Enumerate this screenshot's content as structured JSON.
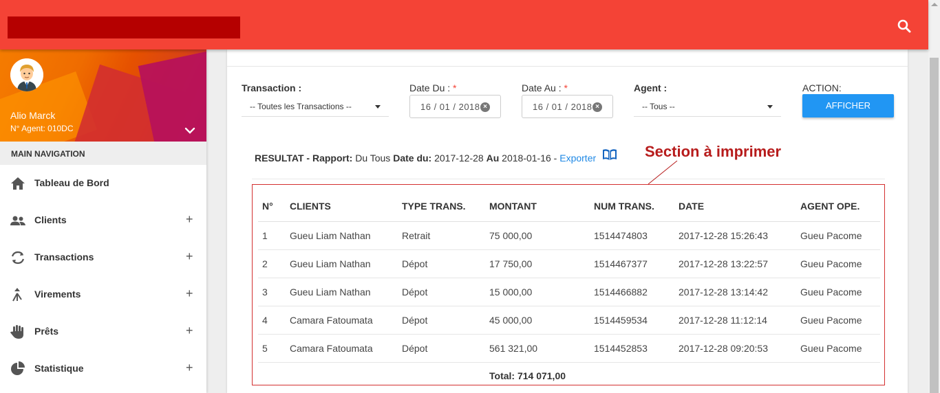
{
  "topbar": {
    "brand_color": "#b50000",
    "search_icon": "search-icon"
  },
  "user": {
    "name": "Alio Marck",
    "agent": "N° Agent: 010DC"
  },
  "nav": {
    "header": "MAIN NAVIGATION",
    "items": [
      {
        "label": "Tableau de Bord",
        "icon": "home-icon",
        "expandable": false
      },
      {
        "label": "Clients",
        "icon": "users-icon",
        "expandable": true
      },
      {
        "label": "Transactions",
        "icon": "sync-icon",
        "expandable": true
      },
      {
        "label": "Virements",
        "icon": "merge-icon",
        "expandable": true
      },
      {
        "label": "Prêts",
        "icon": "hand-icon",
        "expandable": true
      },
      {
        "label": "Statistique",
        "icon": "pie-chart-icon",
        "expandable": true
      }
    ],
    "plus": "+"
  },
  "filters": {
    "transaction_label": "Transaction :",
    "transaction_value": "-- Toutes les Transactions --",
    "date_du_label": "Date Du :",
    "date_du_value": "16 / 01 / 2018",
    "date_au_label": "Date Au :",
    "date_au_value": "16 / 01 / 2018",
    "required_mark": "*",
    "agent_label": "Agent :",
    "agent_value": "-- Tous --",
    "action_label": "ACTION:",
    "afficher_button": "AFFICHER"
  },
  "result": {
    "resultat": "RESULTAT - Rapport:",
    "rapport_value": "Du Tous",
    "date_du_label": "Date du:",
    "date_du_value": "2017-12-28",
    "au_label": "Au",
    "au_value": "2018-01-16 -",
    "export_link": "Exporter"
  },
  "annotation": {
    "text": "Section à imprimer"
  },
  "table": {
    "columns": [
      "N°",
      "CLIENTS",
      "TYPE TRANS.",
      "MONTANT",
      "NUM TRANS.",
      "DATE",
      "AGENT OPE."
    ],
    "rows": [
      [
        "1",
        "Gueu Liam Nathan",
        "Retrait",
        "75 000,00",
        "1514474803",
        "2017-12-28 15:26:43",
        "Gueu Pacome"
      ],
      [
        "2",
        "Gueu Liam Nathan",
        "Dépot",
        "17 750,00",
        "1514467377",
        "2017-12-28 13:22:57",
        "Gueu Pacome"
      ],
      [
        "3",
        "Gueu Liam Nathan",
        "Dépot",
        "15 000,00",
        "1514466882",
        "2017-12-28 13:14:42",
        "Gueu Pacome"
      ],
      [
        "4",
        "Camara Fatoumata",
        "Dépot",
        "45 000,00",
        "1514459534",
        "2017-12-28 11:12:14",
        "Gueu Pacome"
      ],
      [
        "5",
        "Camara Fatoumata",
        "Dépot",
        "561 321,00",
        "1514452853",
        "2017-12-28 09:20:53",
        "Gueu Pacome"
      ]
    ],
    "total": "Total: 714 071,00"
  },
  "colors": {
    "topbar": "#f44336",
    "accent": "#2196f3",
    "print_border": "#d32f2f",
    "annotation": "#b71c1c"
  }
}
